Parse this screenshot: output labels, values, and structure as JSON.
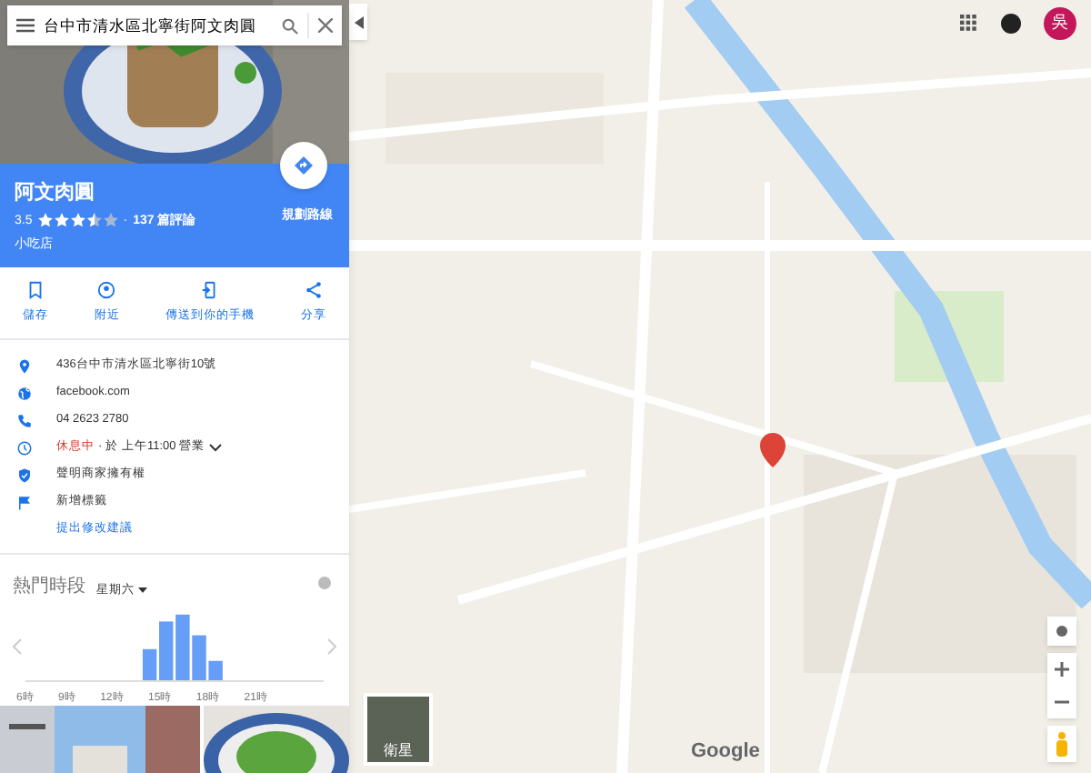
{
  "search": {
    "value": "台中市清水區北寧街阿文肉圓"
  },
  "place": {
    "name": "阿文肉圓",
    "rating": "3.5",
    "stars": 3.5,
    "reviews_separator": "·",
    "reviews": "137 篇評論",
    "category": "小吃店",
    "directions_label": "規劃路線"
  },
  "actions": [
    {
      "kind": "save",
      "label": "儲存"
    },
    {
      "kind": "nearby",
      "label": "附近"
    },
    {
      "kind": "phone",
      "label": "傳送到你的手機"
    },
    {
      "kind": "share",
      "label": "分享"
    }
  ],
  "info": [
    {
      "kind": "address",
      "text": "436台中市清水區北寧街10號"
    },
    {
      "kind": "web",
      "text": "facebook.com"
    },
    {
      "kind": "phone",
      "text": "04 2623 2780"
    },
    {
      "kind": "hours",
      "status": "休息中",
      "separator": "·",
      "text": "於 上午11:00 營業"
    },
    {
      "kind": "verified",
      "text": "聲明商家擁有權"
    },
    {
      "kind": "flag",
      "text": "新增標籤"
    },
    {
      "kind": "link",
      "text": "提出修改建議"
    }
  ],
  "popular_times": {
    "title": "熱門時段",
    "day": "星期六",
    "hour_labels": [
      "6時",
      "9時",
      "12時",
      "15時",
      "18時",
      "21時"
    ]
  },
  "account": {
    "initial": "吳"
  },
  "map": {
    "layer_label": "衛星",
    "logo": "Google"
  }
}
